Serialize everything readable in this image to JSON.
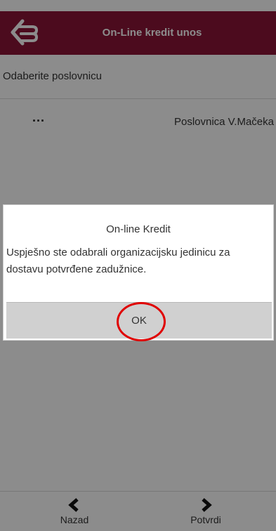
{
  "header": {
    "title": "On-Line kredit unos",
    "logo_icon": "bank-logo-icon",
    "color": "#8a1538"
  },
  "section": {
    "label": "Odaberite poslovnicu"
  },
  "branch_list": {
    "items": [
      {
        "more": "...",
        "name": "Poslovnica V.Mačeka"
      }
    ]
  },
  "dialog": {
    "title": "On-line Kredit",
    "message": "Uspješno ste odabrali organizacijsku jedinicu za dostavu potvrđene zadužnice.",
    "ok_label": "OK"
  },
  "footer": {
    "back_label": "Nazad",
    "back_icon": "chevron-left-icon",
    "next_label": "Potvrdi",
    "next_icon": "chevron-right-icon"
  },
  "annotation": {
    "highlight_color": "#e00000",
    "target": "OK"
  }
}
